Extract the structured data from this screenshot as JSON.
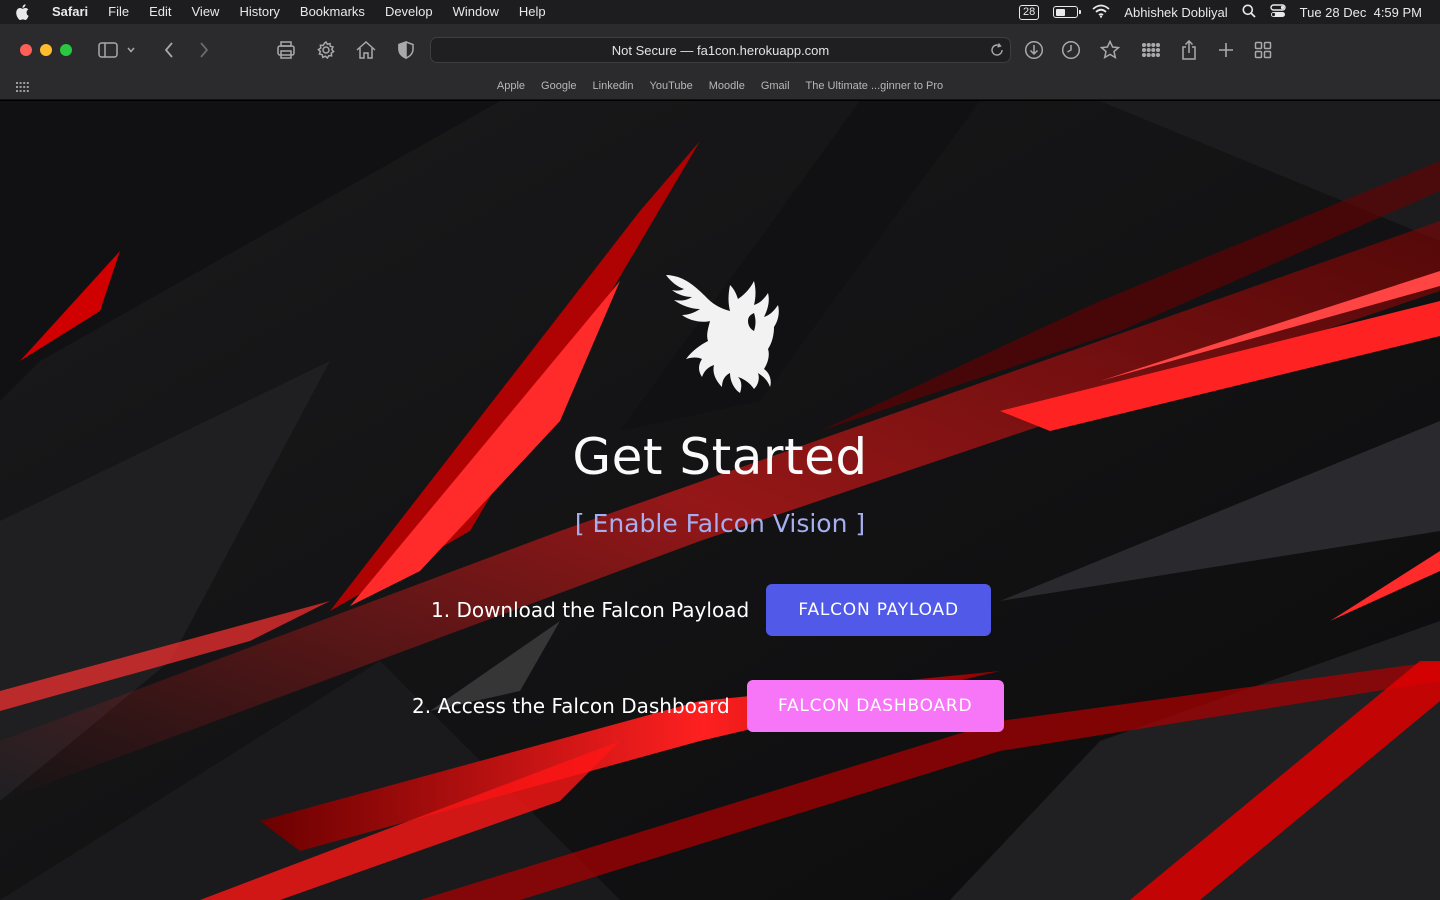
{
  "menubar": {
    "app": "Safari",
    "items": [
      "File",
      "Edit",
      "View",
      "History",
      "Bookmarks",
      "Develop",
      "Window",
      "Help"
    ],
    "badge": "28",
    "user": "Abhishek Dobliyal",
    "datetime": "Tue 28 Dec  4:59 PM",
    "icons": [
      "apple-icon",
      "battery-icon",
      "wifi-icon",
      "spotlight-icon",
      "control-center-icon"
    ]
  },
  "browser": {
    "address": "Not Secure — fa1con.herokuapp.com",
    "favorites": [
      "Apple",
      "Google",
      "Linkedin",
      "YouTube",
      "Moodle",
      "Gmail",
      "The Ultimate ...ginner to Pro"
    ]
  },
  "page": {
    "title": "Get Started",
    "subtitle": "[ Enable Falcon Vision ]",
    "step1_label": "1. Download the Falcon Payload",
    "step1_button": "FALCON PAYLOAD",
    "step2_label": "2. Access the Falcon Dashboard",
    "step2_button": "FALCON DASHBOARD",
    "colors": {
      "payload_button": "#5059e8",
      "dashboard_button": "#f775f7",
      "subtitle": "#a6aeef",
      "accent_red": "#e0101a"
    }
  }
}
